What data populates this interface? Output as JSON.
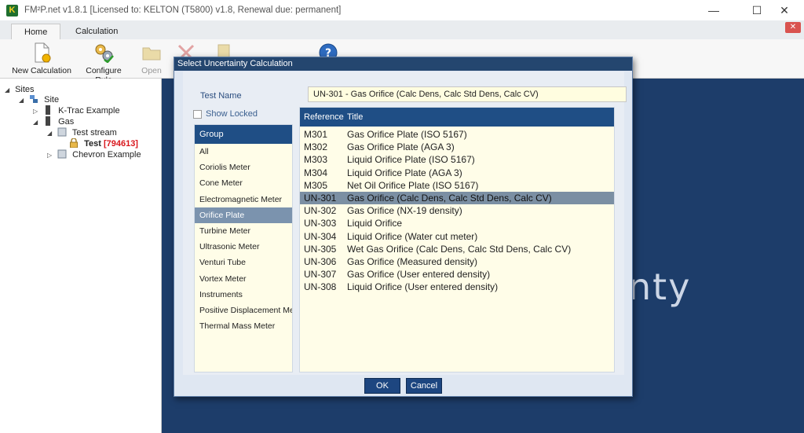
{
  "window": {
    "logo_letter": "K",
    "title": "FM²P.net v1.8.1 [Licensed to: KELTON  (T5800) v1.8, Renewal due: permanent]",
    "minimize": "—",
    "maximize": "☐",
    "close": "✕"
  },
  "ribbon": {
    "tabs": [
      "Home",
      "Calculation"
    ],
    "buttons": {
      "new_calculation": "New Calculation",
      "configure_rule": "Configure Rule",
      "open": "Open"
    },
    "mini_close": "✕"
  },
  "tree": {
    "root": "Sites",
    "site": "Site",
    "ktrac": "K-Trac Example",
    "gas": "Gas",
    "test_stream": "Test stream",
    "test": "Test",
    "test_tag": "[794613]",
    "chevron": "Chevron Example"
  },
  "background": {
    "partial_word": "nty"
  },
  "dialog": {
    "title": "Select Uncertainty Calculation",
    "test_name_label": "Test Name",
    "test_name_value": "UN-301 - Gas Orifice (Calc Dens, Calc Std Dens, Calc CV)",
    "show_locked": "Show Locked",
    "group_header": "Group",
    "groups": [
      "All",
      "Coriolis Meter",
      "Cone Meter",
      "Electromagnetic Meter",
      "Orifice Plate",
      "Turbine Meter",
      "Ultrasonic Meter",
      "Venturi Tube",
      "Vortex Meter",
      "Instruments",
      "Positive Displacement Meter",
      "Thermal Mass Meter"
    ],
    "selected_group": "Orifice Plate",
    "columns": {
      "reference": "Reference",
      "title": "Title"
    },
    "rows": [
      {
        "ref": "M301",
        "title": "Gas Orifice Plate (ISO 5167)"
      },
      {
        "ref": "M302",
        "title": "Gas Orifice Plate (AGA 3)"
      },
      {
        "ref": "M303",
        "title": "Liquid Orifice Plate (ISO 5167)"
      },
      {
        "ref": "M304",
        "title": "Liquid Orifice Plate (AGA 3)"
      },
      {
        "ref": "M305",
        "title": "Net Oil Orifice Plate (ISO 5167)"
      },
      {
        "ref": "UN-301",
        "title": "Gas Orifice (Calc Dens, Calc Std Dens, Calc CV)"
      },
      {
        "ref": "UN-302",
        "title": "Gas Orifice (NX-19 density)"
      },
      {
        "ref": "UN-303",
        "title": "Liquid Orifice"
      },
      {
        "ref": "UN-304",
        "title": "Liquid Orifice (Water cut meter)"
      },
      {
        "ref": "UN-305",
        "title": "Wet Gas Orifice (Calc Dens, Calc Std Dens, Calc CV)"
      },
      {
        "ref": "UN-306",
        "title": "Gas Orifice (Measured density)"
      },
      {
        "ref": "UN-307",
        "title": "Gas Orifice (User entered density)"
      },
      {
        "ref": "UN-308",
        "title": "Liquid Orifice (User entered density)"
      }
    ],
    "selected_ref": "UN-301",
    "ok": "OK",
    "cancel": "Cancel"
  }
}
